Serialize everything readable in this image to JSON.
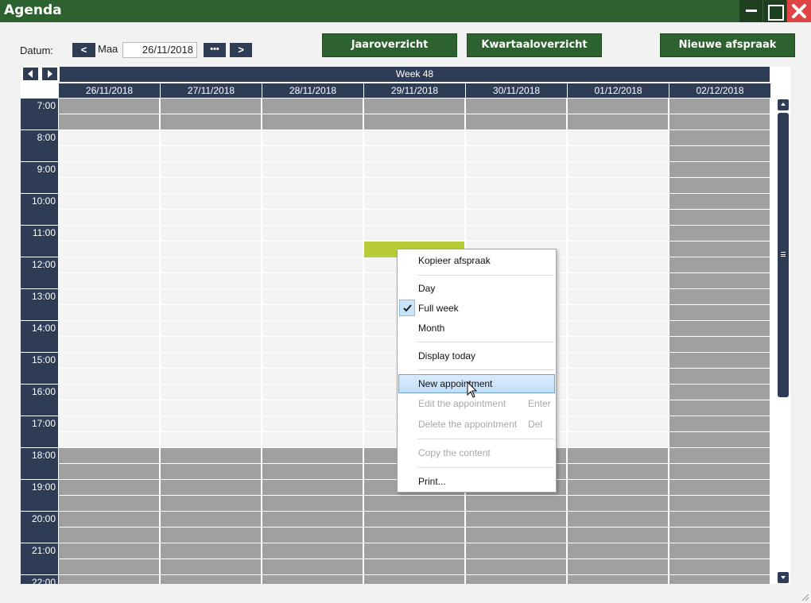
{
  "window": {
    "title": "Agenda"
  },
  "toolbar": {
    "datum_label": "Datum:",
    "prev_label": "<",
    "day_label": "Maa",
    "date_value": "26/11/2018",
    "dots_label": "•••",
    "next_label": ">",
    "jaaroverzicht_label": "Jaaroverzicht",
    "kwartaaloverzicht_label": "Kwartaaloverzicht",
    "nieuwe_afspraak_label": "Nieuwe afspraak"
  },
  "calendar": {
    "week_label": "Week 48",
    "days": [
      "26/11/2018",
      "27/11/2018",
      "28/11/2018",
      "29/11/2018",
      "30/11/2018",
      "01/12/2018",
      "02/12/2018"
    ],
    "hours": [
      "7:00",
      "8:00",
      "9:00",
      "10:00",
      "11:00",
      "12:00",
      "13:00",
      "14:00",
      "15:00",
      "16:00",
      "17:00",
      "18:00",
      "19:00",
      "20:00",
      "21:00",
      "22:00"
    ],
    "work_start_hour": 8,
    "work_end_hour": 18,
    "nonworking_day_index": 6,
    "appointment": {
      "day_index": 3,
      "start": "11:30",
      "end": "12:00"
    }
  },
  "context_menu": {
    "kopieer_afspraak": "Kopieer afspraak",
    "day": "Day",
    "full_week": "Full week",
    "month": "Month",
    "display_today": "Display today",
    "new_appointment": "New appointment",
    "edit_appointment": "Edit the appointment",
    "edit_shortcut": "Enter",
    "delete_appointment": "Delete the appointment",
    "delete_shortcut": "Del",
    "copy_content": "Copy the content",
    "print": "Print..."
  },
  "colors": {
    "titlebar": "#2e6130",
    "navy": "#2e3d55",
    "appointment": "#b7cc36",
    "nonworking": "#a0a0a0",
    "working": "#f4f4f4"
  }
}
